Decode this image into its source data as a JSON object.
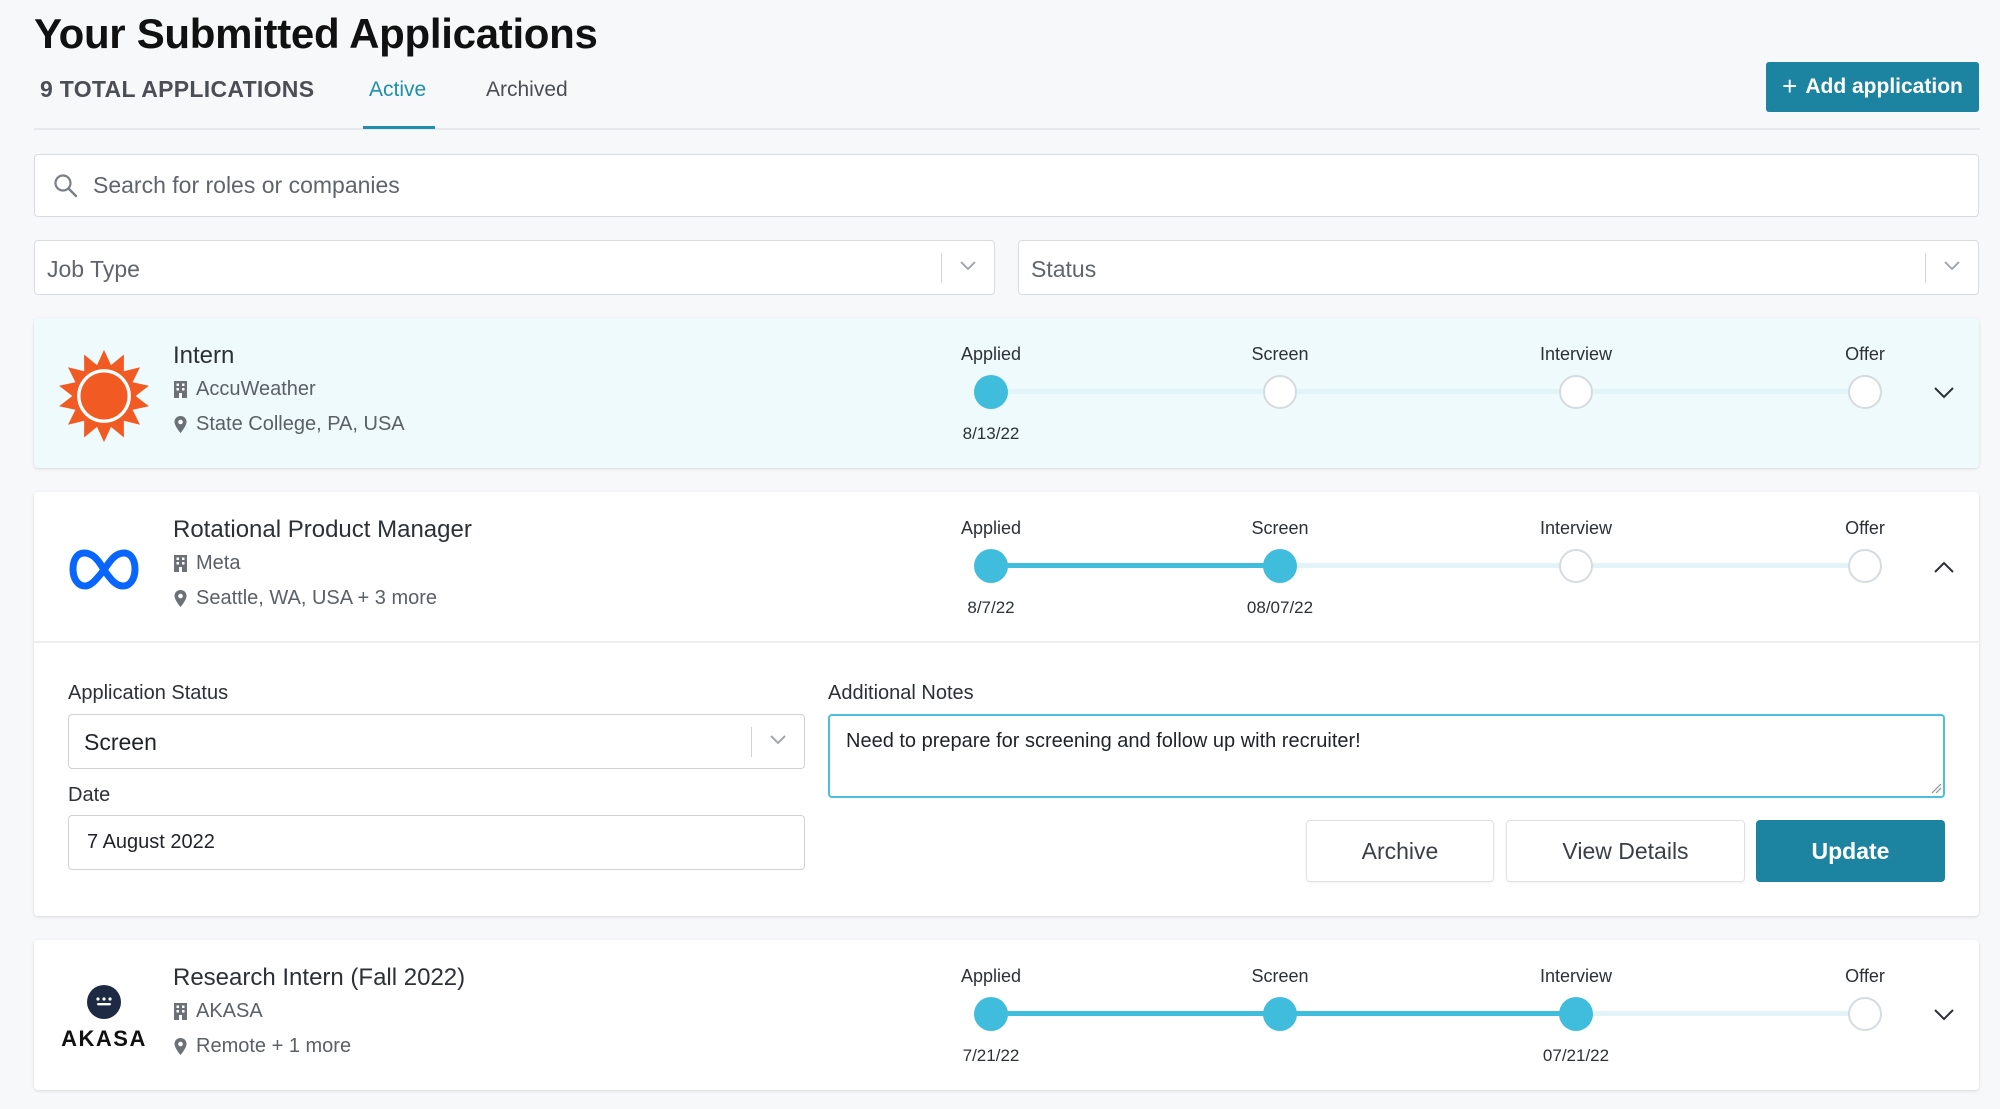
{
  "header": {
    "title": "Your Submitted Applications",
    "total_label": "9 TOTAL APPLICATIONS",
    "tabs": [
      {
        "label": "Active"
      },
      {
        "label": "Archived"
      }
    ],
    "add_button_label": "Add application"
  },
  "search": {
    "placeholder": "Search for roles or companies"
  },
  "filters": {
    "job_type_placeholder": "Job Type",
    "status_placeholder": "Status"
  },
  "colors": {
    "accent": "#1c84a0",
    "progress": "#40bcdc",
    "highlight_bg": "#eefafc"
  },
  "applications": [
    {
      "title": "Intern",
      "company": "AccuWeather",
      "location": "State College, PA, USA",
      "logo": "accuweather-sun-icon",
      "stages": [
        {
          "label": "Applied",
          "date": "8/13/22",
          "done": true
        },
        {
          "label": "Screen",
          "date": "",
          "done": false
        },
        {
          "label": "Interview",
          "date": "",
          "done": false
        },
        {
          "label": "Offer",
          "date": "",
          "done": false
        }
      ],
      "expanded": false
    },
    {
      "title": "Rotational Product Manager",
      "company": "Meta",
      "location": "Seattle, WA, USA + 3 more",
      "logo": "meta-infinity-icon",
      "stages": [
        {
          "label": "Applied",
          "date": "8/7/22",
          "done": true
        },
        {
          "label": "Screen",
          "date": "08/07/22",
          "done": true
        },
        {
          "label": "Interview",
          "date": "",
          "done": false
        },
        {
          "label": "Offer",
          "date": "",
          "done": false
        }
      ],
      "expanded": true,
      "details": {
        "status_label": "Application Status",
        "status_value": "Screen",
        "date_label": "Date",
        "date_value": "7 August 2022",
        "notes_label": "Additional Notes",
        "notes_value": "Need to prepare for screening and follow up with recruiter!",
        "archive_label": "Archive",
        "view_details_label": "View Details",
        "update_label": "Update"
      }
    },
    {
      "title": "Research Intern (Fall 2022)",
      "company": "AKASA",
      "location": "Remote + 1 more",
      "logo": "akasa-logo",
      "logo_text": "AKASA",
      "stages": [
        {
          "label": "Applied",
          "date": "7/21/22",
          "done": true
        },
        {
          "label": "Screen",
          "date": "",
          "done": true
        },
        {
          "label": "Interview",
          "date": "07/21/22",
          "done": true
        },
        {
          "label": "Offer",
          "date": "",
          "done": false
        }
      ],
      "expanded": false
    }
  ]
}
